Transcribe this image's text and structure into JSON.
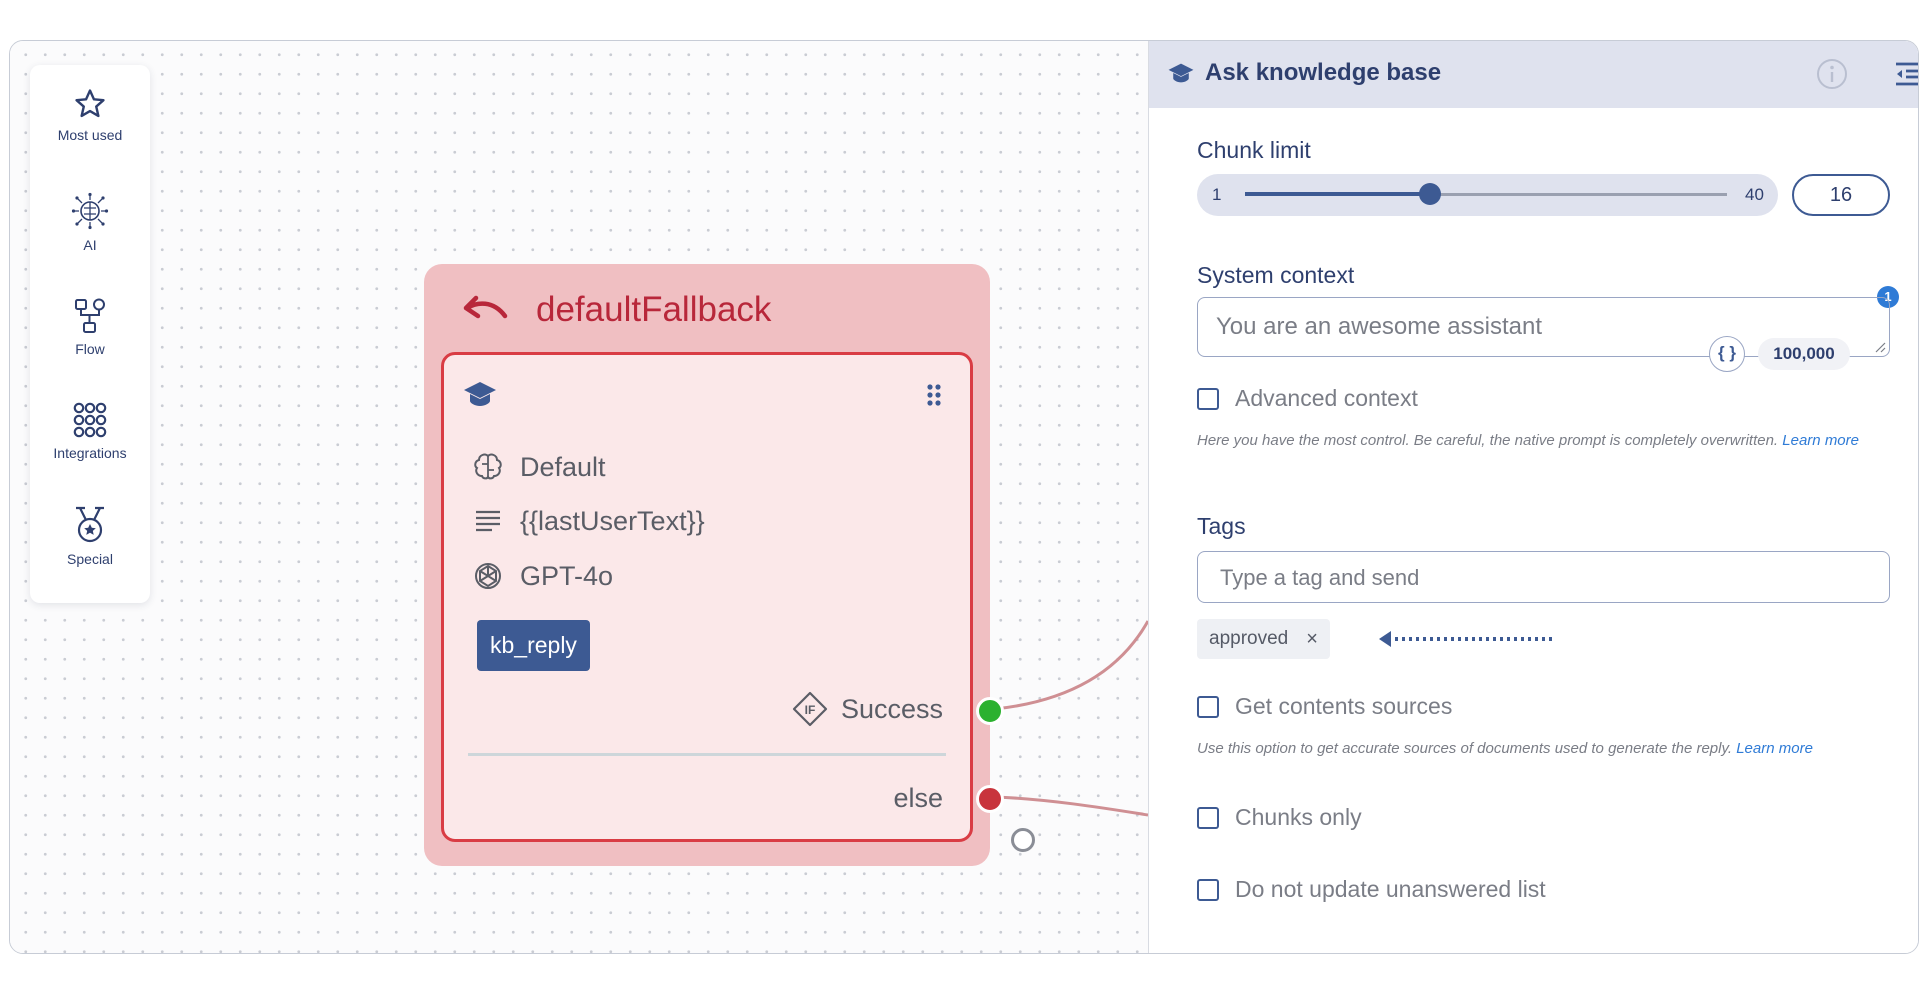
{
  "toolbar": {
    "items": [
      {
        "label": "Most used",
        "icon": "star-icon"
      },
      {
        "label": "AI",
        "icon": "brain-circuit-icon"
      },
      {
        "label": "Flow",
        "icon": "flow-icon"
      },
      {
        "label": "Integrations",
        "icon": "grid-dots-icon"
      },
      {
        "label": "Special",
        "icon": "medal-icon"
      }
    ]
  },
  "node": {
    "title": "defaultFallback",
    "rows": [
      {
        "icon": "brain-icon",
        "text": "Default"
      },
      {
        "icon": "text-lines-icon",
        "text": "{{lastUserText}}"
      },
      {
        "icon": "openai-icon",
        "text": "GPT-4o"
      }
    ],
    "tag": "kb_reply",
    "success_label": "Success",
    "else_label": "else"
  },
  "panel": {
    "title": "Ask knowledge base",
    "chunk_limit": {
      "label": "Chunk limit",
      "min": "1",
      "max": "40",
      "value": "16"
    },
    "system_context": {
      "label": "System context",
      "placeholder": "You are an awesome assistant",
      "char_limit": "100,000",
      "badge": "1"
    },
    "advanced_context": {
      "label": "Advanced context",
      "help": "Here you have the most control. Be careful, the native prompt is completely overwritten.",
      "link": "Learn more"
    },
    "tags": {
      "label": "Tags",
      "placeholder": "Type a tag and send",
      "items": [
        "approved"
      ],
      "remove_symbol": "×"
    },
    "get_sources": {
      "label": "Get contents sources",
      "help": "Use this option to get accurate sources of documents used to generate the reply.",
      "link": "Learn more"
    },
    "chunks_only": {
      "label": "Chunks only"
    },
    "no_update_unanswered": {
      "label": "Do not update unanswered list"
    }
  },
  "colors": {
    "accent": "#3d5a93",
    "node_bg": "#f0bfc2",
    "node_border": "#d93c44",
    "success_port": "#2bb12f",
    "else_port": "#c8343c"
  }
}
